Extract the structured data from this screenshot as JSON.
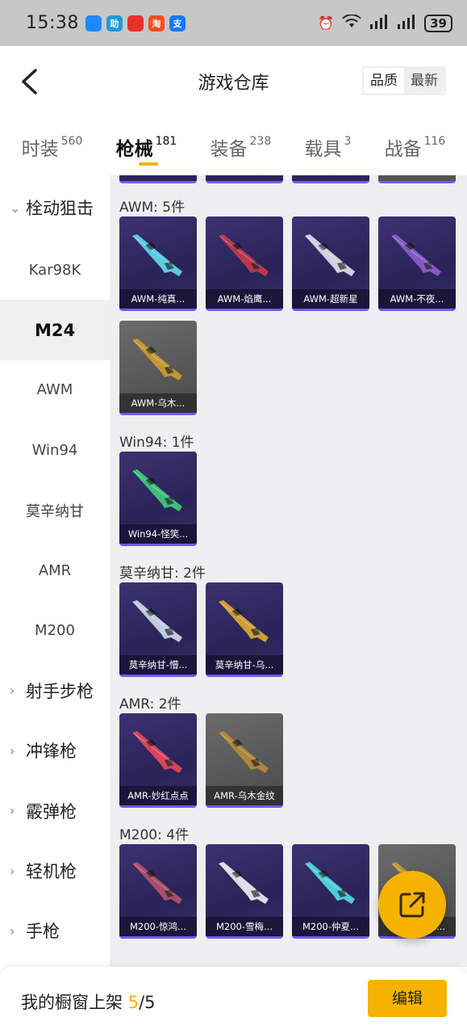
{
  "status_bar": {
    "time": "15:38",
    "app_icons": [
      {
        "icon": "chat-bubble-icon",
        "color": "#1e88ff"
      },
      {
        "icon": "study-app-icon",
        "color": "#1e9be0",
        "text": "助"
      },
      {
        "icon": "red-app-icon",
        "color": "#e8312f"
      },
      {
        "icon": "taobao-icon",
        "color": "#ff4b1f",
        "text": "淘"
      },
      {
        "icon": "alipay-icon",
        "color": "#1677ff",
        "text": "支"
      }
    ],
    "network": "6",
    "battery": "39"
  },
  "header": {
    "title": "游戏仓库",
    "sort_options": [
      "品质",
      "最新"
    ],
    "sort_active": "品质"
  },
  "tabs": [
    {
      "label": "时装",
      "count": "560",
      "active": false
    },
    {
      "label": "枪械",
      "count": "181",
      "active": true
    },
    {
      "label": "装备",
      "count": "238",
      "active": false
    },
    {
      "label": "载具",
      "count": "3",
      "active": false
    },
    {
      "label": "战备",
      "count": "116",
      "active": false
    }
  ],
  "sidebar": [
    {
      "label": "栓动狙击",
      "type": "group",
      "expanded": true
    },
    {
      "label": "Kar98K",
      "type": "item"
    },
    {
      "label": "M24",
      "type": "item",
      "active": true
    },
    {
      "label": "AWM",
      "type": "item"
    },
    {
      "label": "Win94",
      "type": "item"
    },
    {
      "label": "莫辛纳甘",
      "type": "item"
    },
    {
      "label": "AMR",
      "type": "item"
    },
    {
      "label": "M200",
      "type": "item"
    },
    {
      "label": "射手步枪",
      "type": "group"
    },
    {
      "label": "冲锋枪",
      "type": "group"
    },
    {
      "label": "霰弹枪",
      "type": "group"
    },
    {
      "label": "轻机枪",
      "type": "group"
    },
    {
      "label": "手枪",
      "type": "group"
    }
  ],
  "sections": [
    {
      "title": "AWM: 5件",
      "items": [
        {
          "name": "AWM-纯真...",
          "rarity": "purple",
          "gun_color": "#5fd3e8"
        },
        {
          "name": "AWM-焰鹰...",
          "rarity": "purple",
          "gun_color": "#c0394a"
        },
        {
          "name": "AWM-超新星",
          "rarity": "purple",
          "gun_color": "#d9d9e8"
        },
        {
          "name": "AWM-不夜...",
          "rarity": "purple",
          "gun_color": "#8a5cc9"
        },
        {
          "name": "AWM-乌木...",
          "rarity": "gray",
          "gun_color": "#c99a2e"
        }
      ]
    },
    {
      "title": "Win94: 1件",
      "items": [
        {
          "name": "Win94-怪笑...",
          "rarity": "purple",
          "gun_color": "#3ec77a"
        }
      ]
    },
    {
      "title": "莫辛纳甘: 2件",
      "items": [
        {
          "name": "莫辛纳甘-懵...",
          "rarity": "purple",
          "gun_color": "#c8d4e6"
        },
        {
          "name": "莫辛纳甘-乌...",
          "rarity": "purple",
          "gun_color": "#d9a532"
        }
      ]
    },
    {
      "title": "AMR: 2件",
      "items": [
        {
          "name": "AMR-妙红点点",
          "rarity": "purple",
          "gun_color": "#e0485a"
        },
        {
          "name": "AMR-乌木金纹",
          "rarity": "gray",
          "gun_color": "#b08a3a"
        }
      ]
    },
    {
      "title": "M200: 4件",
      "items": [
        {
          "name": "M200-惊鸿...",
          "rarity": "purple",
          "gun_color": "#b0506a"
        },
        {
          "name": "M200-雪梅...",
          "rarity": "purple",
          "gun_color": "#e6e6ee"
        },
        {
          "name": "M200-仲夏...",
          "rarity": "purple",
          "gun_color": "#4fd6e0"
        },
        {
          "name": "M200-乌木...",
          "rarity": "gray",
          "gun_color": "#c99a2e"
        }
      ]
    }
  ],
  "bottom_bar": {
    "label": "我的橱窗上架",
    "count_current": "5",
    "count_sep": "/",
    "count_total": "5",
    "edit_label": "编辑"
  },
  "colors": {
    "accent": "#f5b300",
    "purple_rarity": "#6d5cf7"
  }
}
